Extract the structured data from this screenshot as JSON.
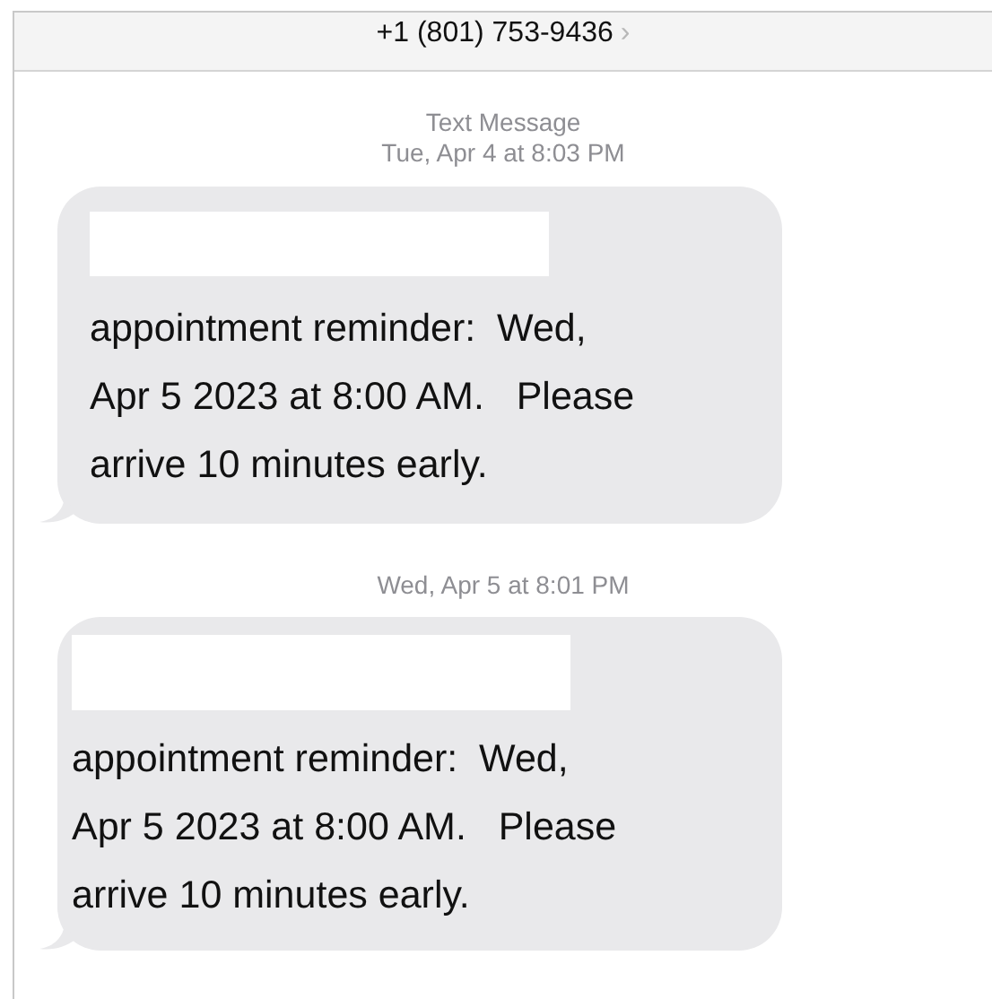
{
  "header": {
    "title": "+1 (801) 753-9436",
    "chevron": "›"
  },
  "messages": [
    {
      "service": "Text Message",
      "timestamp": "Tue, Apr 4 at 8:03 PM",
      "redacted": true,
      "text": "appointment reminder:  Wed,\nApr 5 2023 at 8:00 AM.   Please\narrive 10 minutes early."
    },
    {
      "timestamp": "Wed, Apr 5 at 8:01 PM",
      "redacted": true,
      "text": "appointment reminder:  Wed,\nApr 5 2023 at 8:00 AM.   Please\narrive 10 minutes early."
    }
  ]
}
